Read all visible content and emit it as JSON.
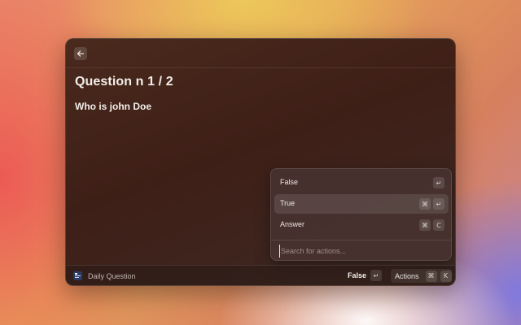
{
  "window": {
    "title": "Question n 1  /  2",
    "question": "Who is john Doe"
  },
  "icons": {
    "back": "arrow-left-icon",
    "enter": "↵",
    "command": "⌘",
    "app": "daily-question-app-icon"
  },
  "action_panel": {
    "items": [
      {
        "label": "False",
        "keys": [
          "↵"
        ],
        "selected": false
      },
      {
        "label": "True",
        "keys": [
          "⌘",
          "↵"
        ],
        "selected": true
      },
      {
        "label": "Answer",
        "keys": [
          "⌘",
          "C"
        ],
        "selected": false
      }
    ],
    "search_placeholder": "Search for actions...",
    "search_value": ""
  },
  "footer": {
    "app_name": "Daily Question",
    "primary_action_label": "False",
    "primary_action_key": "↵",
    "actions_label": "Actions",
    "actions_keys": [
      "⌘",
      "K"
    ]
  },
  "colors": {
    "window_bg": "#3e1f17",
    "text": "#f3eeea",
    "app_icon": "#2a3c64"
  }
}
